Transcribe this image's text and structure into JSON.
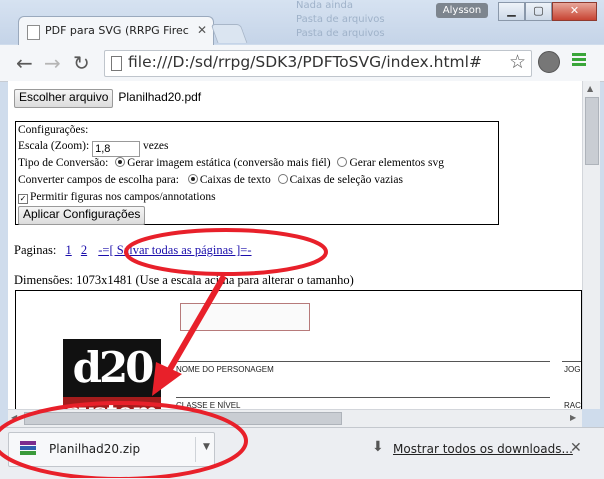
{
  "background_ghost": {
    "line1": "Nada ainda",
    "line2": "Pasta de arquivos",
    "line3": "Pasta de arquivos"
  },
  "window": {
    "user_badge": "Alysson",
    "tab_title": "PDF para SVG (RRPG Firec",
    "url": "file:///D:/sd/rrpg/SDK3/PDFToSVG/index.html#"
  },
  "page": {
    "choose_file_button": "Escolher arquivo",
    "chosen_file": "Planilhad20.pdf",
    "config": {
      "heading": "Configurações:",
      "scale_label": "Escala (Zoom):",
      "scale_value": "1,8",
      "scale_suffix": "vezes",
      "conversion_label": "Tipo de Conversão:",
      "conversion_options": [
        "Gerar imagem estática (conversão mais fiél)",
        "Gerar elementos svg"
      ],
      "fields_label": "Converter campos de escolha para:",
      "fields_options": [
        "Caixas de texto",
        "Caixas de seleção vazias"
      ],
      "allow_figures": "Permitir figuras nos campos/annotations",
      "apply_button": "Aplicar Configurações"
    },
    "pages_label": "Paginas:",
    "page_links": [
      "1",
      "2"
    ],
    "save_all_link": "-=[ Salvar todas as páginas ]=-",
    "dimensions": "Dimensões: 1073x1481 (Use a escala acima para alterar o tamanho)",
    "preview": {
      "logo_top": "d20",
      "logo_bottom": "system",
      "field_character": "NOME DO PERSONAGEM",
      "field_class": "CLASSE E NÍVEL",
      "field_right1": "JOG",
      "field_right2": "RAC"
    }
  },
  "downloads": {
    "file_name": "Planilhad20.zip",
    "show_all": "Mostrar todos os downloads..."
  },
  "colors": {
    "annotation_red": "#e8202a",
    "link": "#1a0dab",
    "menu_green": "#3aa63a"
  }
}
